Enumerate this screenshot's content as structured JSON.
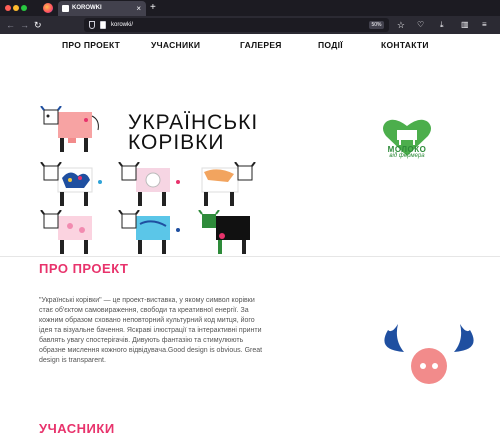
{
  "browser": {
    "tab_title": "KOROWKI",
    "url": "korowki/",
    "zoom": "50%",
    "tab_close": "×",
    "new_tab": "+"
  },
  "nav": {
    "items": [
      {
        "label": "ПРО ПРОЕКТ"
      },
      {
        "label": "УЧАСНИКИ"
      },
      {
        "label": "ГАЛЕРЕЯ"
      },
      {
        "label": "ПОДІЇ"
      },
      {
        "label": "КОНТАКТИ"
      }
    ]
  },
  "hero": {
    "title_line1": "УКРАЇНСЬКІ",
    "title_line2": "КОРІВКИ",
    "partner_logo": {
      "line1": "МОЛОКО",
      "line2": "від фермера",
      "color": "#2e8b3a"
    }
  },
  "about": {
    "title": "ПРО ПРОЕКТ",
    "text": "\"Українські корівки\" — це проект-виставка, у якому символ корівки стає об'єктом самовираження, свободи та креативної енергії. За кожним образом сховано неповторний культурний код митця, його ідея та візуальне бачення. Яскраві ілюстрації та інтерактивні принти бавлять увагу спостерігачів. Дивують фантазію та стимулюють образне мислення кожного відвідувача.Good design is obvious. Great design is transparent."
  },
  "participants": {
    "title": "УЧАСНИКИ"
  },
  "colors": {
    "accent": "#e8336c",
    "horn_blue": "#1f4fa0",
    "pig_pink": "#f28b8b"
  }
}
